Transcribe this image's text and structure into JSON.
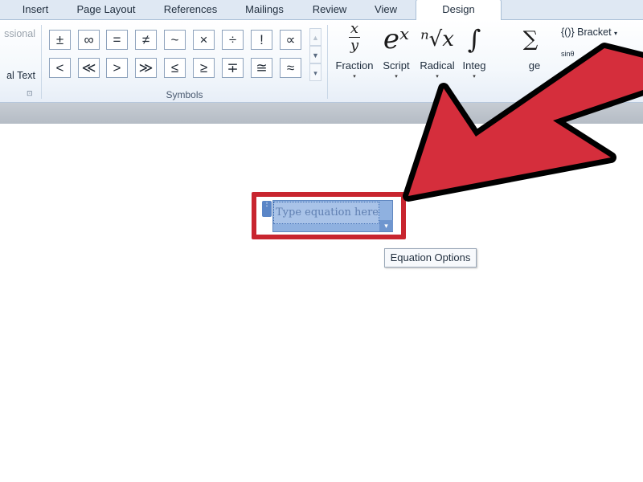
{
  "tabs": [
    {
      "label": "Insert",
      "active": false
    },
    {
      "label": "Page Layout",
      "active": false
    },
    {
      "label": "References",
      "active": false
    },
    {
      "label": "Mailings",
      "active": false
    },
    {
      "label": "Review",
      "active": false
    },
    {
      "label": "View",
      "active": false
    },
    {
      "label": "Design",
      "active": true
    }
  ],
  "tools_group": {
    "line1": "ssional",
    "line2": "al Text"
  },
  "symbols_group": {
    "label": "Symbols",
    "row1": [
      "±",
      "∞",
      "=",
      "≠",
      "~",
      "×",
      "÷",
      "!",
      "∝"
    ],
    "row2": [
      "<",
      "≪",
      ">",
      "≫",
      "≤",
      "≥",
      "∓",
      "≅",
      "≈"
    ],
    "scroll_up": "▲",
    "scroll_down": "▼",
    "more": "▾"
  },
  "structures_group": {
    "fraction": {
      "label": "Fraction",
      "glyph_top": "x",
      "glyph_bottom": "y"
    },
    "script": {
      "label": "Script",
      "glyph": "eˣ"
    },
    "radical": {
      "label": "Radical",
      "glyph": "ⁿ√x"
    },
    "integral": {
      "label": "Integ",
      "glyph": "∫"
    },
    "large_operator": {
      "label": "ge",
      "glyph": "∑"
    },
    "bracket": {
      "label": "Bracket",
      "glyph": "{()}"
    },
    "function": {
      "glyph": "sinθ"
    },
    "caret": "▾"
  },
  "equation": {
    "placeholder": "Type equation here.",
    "handle_glyph": "⋮",
    "options_glyph": "▾"
  },
  "tooltip": {
    "text": "Equation Options"
  },
  "colors": {
    "highlight": "#c8252f",
    "equation_fill": "#a9c3e8",
    "arrow_fill": "#d52e3c"
  }
}
